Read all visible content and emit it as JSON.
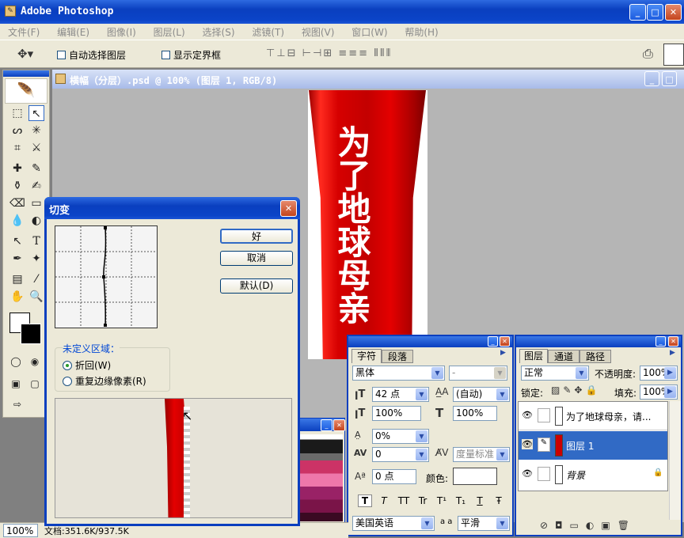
{
  "app": {
    "title": "Adobe Photoshop"
  },
  "menu": [
    "文件(F)",
    "编辑(E)",
    "图像(I)",
    "图层(L)",
    "选择(S)",
    "滤镜(T)",
    "视图(V)",
    "窗口(W)",
    "帮助(H)"
  ],
  "options": {
    "auto_select": "自动选择图层",
    "show_bounds": "显示定界框"
  },
  "document": {
    "title": "横幅（分层）.psd @ 100% (图层 1, RGB/8)",
    "banner_text": "为了地球母亲"
  },
  "status": {
    "zoom": "100%",
    "doc_size": "文档:351.6K/937.5K"
  },
  "shear_dialog": {
    "title": "切变",
    "ok": "好",
    "cancel": "取消",
    "default": "默认(D)",
    "undefined_area_label": "未定义区域：",
    "wrap_around": "折回(W)",
    "repeat_edge": "重复边缘像素(R)"
  },
  "character_panel": {
    "tabs": [
      "字符",
      "段落"
    ],
    "font_family": "黑体",
    "font_style": "-",
    "font_size": "42 点",
    "leading": "(自动)",
    "vertical_scale": "100%",
    "horizontal_scale": "100%",
    "baseline_shift_pct": "0%",
    "kerning": "0",
    "tracking": "度量标准",
    "baseline_shift": "0 点",
    "color_label": "颜色:",
    "style_buttons": [
      "T",
      "T",
      "TT",
      "Tr",
      "T¹",
      "T₁",
      "T",
      "Ŧ"
    ],
    "language": "美国英语",
    "aa_label": "a a",
    "antialias": "平滑"
  },
  "layers_panel": {
    "tabs": [
      "图层",
      "通道",
      "路径"
    ],
    "blend_mode": "正常",
    "opacity_label": "不透明度:",
    "opacity": "100%",
    "lock_label": "锁定:",
    "fill_label": "填充:",
    "fill": "100%",
    "layers": [
      {
        "name": "为了地球母亲，请...",
        "type": "text"
      },
      {
        "name": "图层 1",
        "type": "image",
        "selected": true
      },
      {
        "name": "背景",
        "type": "background"
      }
    ]
  },
  "colors": {
    "banner_red": "#d20000",
    "selection_blue": "#316ac5"
  }
}
